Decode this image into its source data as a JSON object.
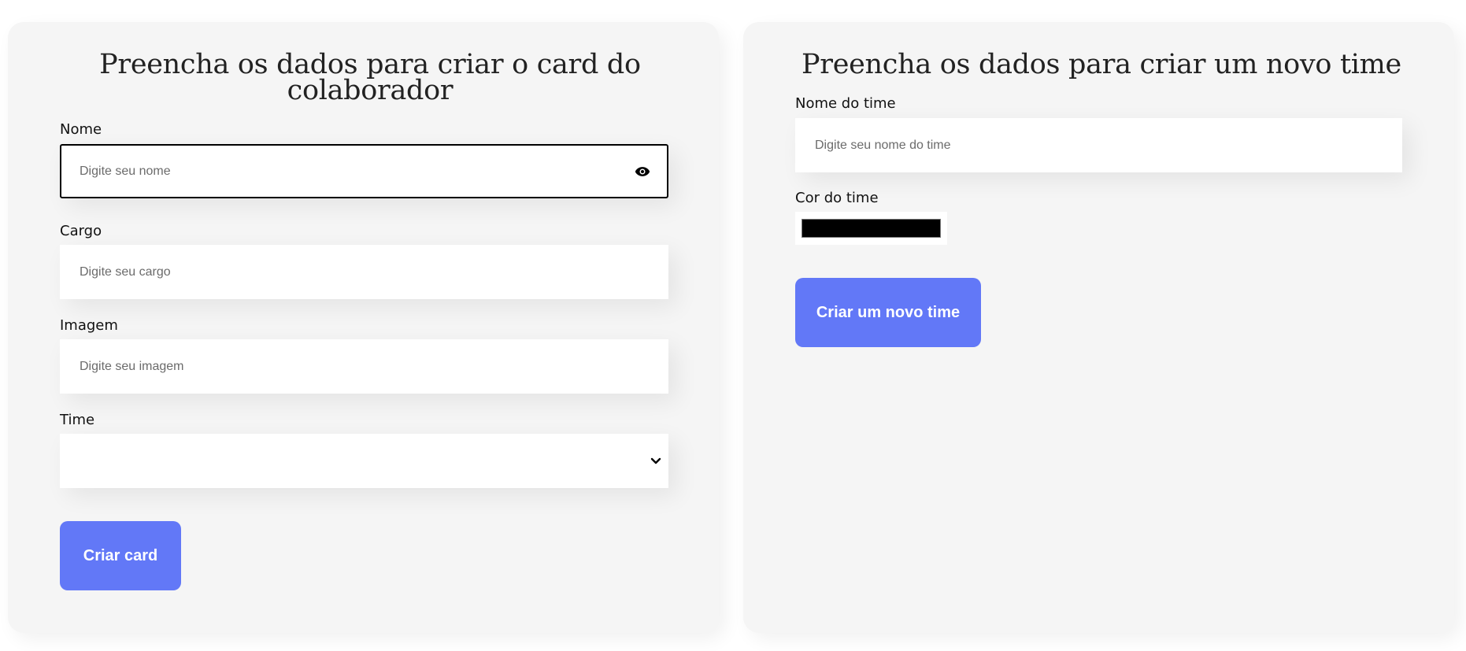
{
  "collaborator_form": {
    "title": "Preencha os dados para criar o card do colaborador",
    "nome": {
      "label": "Nome",
      "placeholder": "Digite seu nome",
      "value": ""
    },
    "cargo": {
      "label": "Cargo",
      "placeholder": "Digite seu cargo",
      "value": ""
    },
    "imagem": {
      "label": "Imagem",
      "placeholder": "Digite seu imagem",
      "value": ""
    },
    "time": {
      "label": "Time",
      "selected": ""
    },
    "submit_label": "Criar card"
  },
  "team_form": {
    "title": "Preencha os dados para criar um novo time",
    "nome_time": {
      "label": "Nome do time",
      "placeholder": "Digite seu nome do time",
      "value": ""
    },
    "cor_time": {
      "label": "Cor do time",
      "value": "#000000"
    },
    "submit_label": "Criar um novo time"
  },
  "colors": {
    "accent": "#6278f7",
    "panel_bg": "#f5f5f5"
  },
  "icons": {
    "password_toggle": "eye-icon",
    "select_arrow": "chevron-down-icon"
  }
}
